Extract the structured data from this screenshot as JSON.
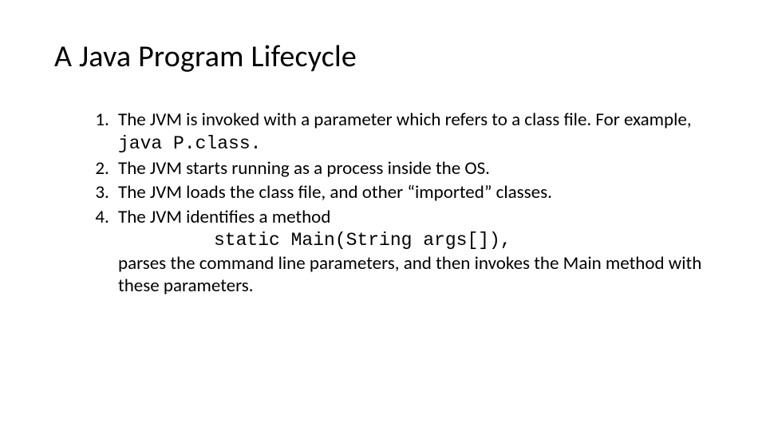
{
  "title": "A Java Program Lifecycle",
  "items": [
    {
      "lead": "The JVM is invoked with a parameter which refers to a class file. For example, ",
      "code": "java P.class.",
      "tail": ""
    },
    {
      "text": "The JVM starts running as a process inside the OS."
    },
    {
      "text": "The JVM loads the class file, and other “imported” classes."
    },
    {
      "lead": "The JVM identifies a method",
      "sig": "static Main(String args[]),",
      "tail": "parses the command line parameters, and then invokes the Main method with these parameters."
    }
  ]
}
